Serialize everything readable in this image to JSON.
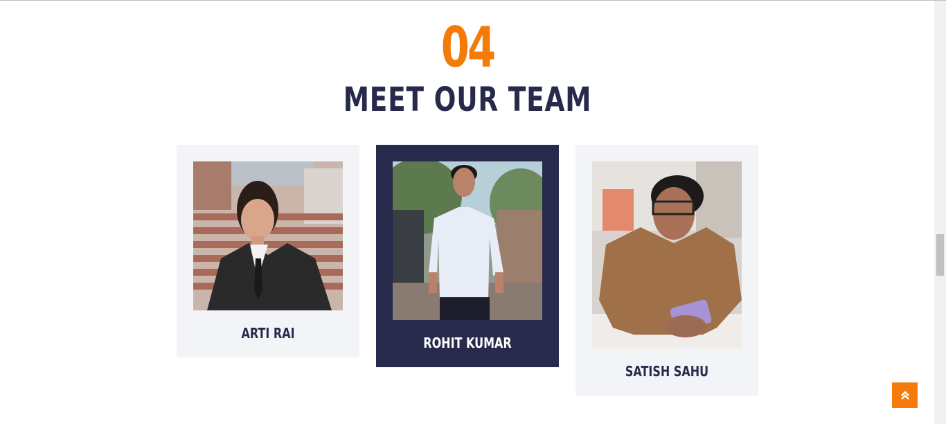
{
  "section": {
    "number": "04",
    "title": "MEET OUR TEAM"
  },
  "team": [
    {
      "name": "ARTI RAI",
      "photo_icon": "person-photo",
      "highlighted": false
    },
    {
      "name": "ROHIT KUMAR",
      "photo_icon": "person-photo",
      "highlighted": true
    },
    {
      "name": "SATISH SAHU",
      "photo_icon": "person-photo",
      "highlighted": false
    }
  ],
  "back_to_top_icon": "double-chevron-up-icon",
  "colors": {
    "accent": "#f47b0a",
    "navy": "#272a4a",
    "card_bg": "#f3f4f8",
    "white": "#ffffff"
  }
}
